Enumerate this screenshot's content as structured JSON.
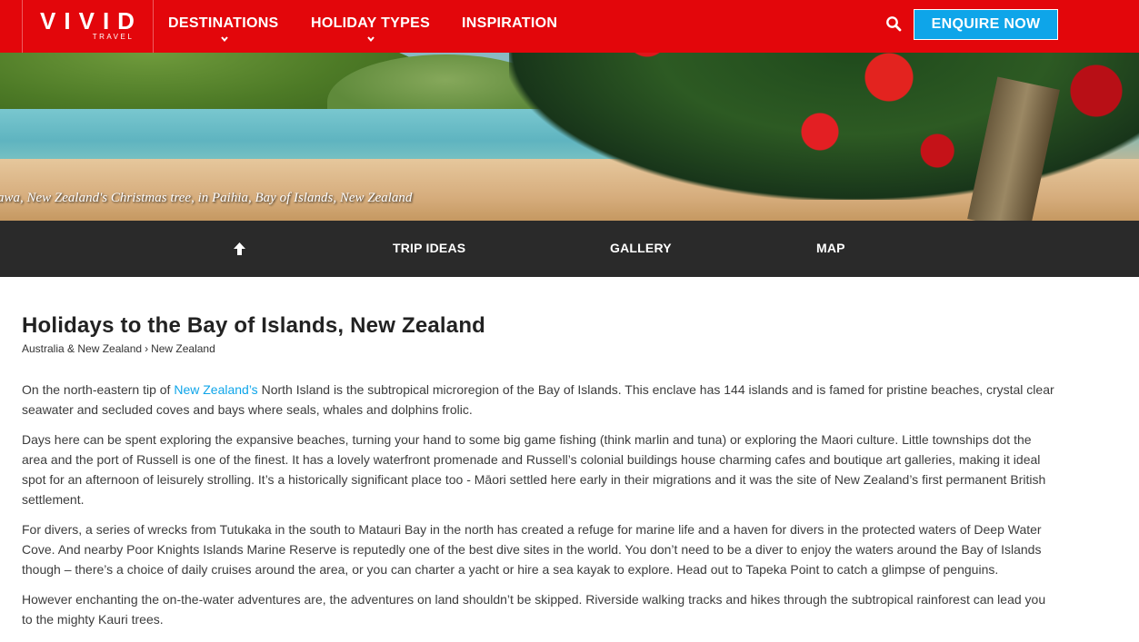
{
  "colors": {
    "brand_red": "#e3060b",
    "accent_blue": "#0ea5e9",
    "subnav_bg": "#2a2a2a"
  },
  "header": {
    "logo_main": "VIVID",
    "logo_sub": "TRAVEL",
    "nav": [
      {
        "label": "DESTINATIONS",
        "has_dropdown": true
      },
      {
        "label": "HOLIDAY TYPES",
        "has_dropdown": true
      },
      {
        "label": "INSPIRATION",
        "has_dropdown": false
      }
    ],
    "search_icon": "search-icon",
    "enquire_label": "ENQUIRE NOW"
  },
  "hero": {
    "caption": "awa, New Zealand's Christmas tree, in Paihia, Bay of Islands, New Zealand"
  },
  "subnav": {
    "back_to_top_icon": "arrow-up-icon",
    "items": [
      {
        "label": "TRIP IDEAS"
      },
      {
        "label": "GALLERY"
      },
      {
        "label": "MAP"
      }
    ]
  },
  "main": {
    "title": "Holidays to the Bay of Islands, New Zealand",
    "breadcrumb": {
      "parent": "Australia & New Zealand",
      "separator": "›",
      "current": "New Zealand"
    },
    "intro": {
      "before": "On the north-eastern tip of ",
      "link": "New Zealand’s",
      "after": " North Island is the subtropical microregion of the Bay of Islands. This enclave has 144 islands and is famed for pristine beaches, crystal clear seawater and secluded coves and bays where seals, whales and dolphins frolic."
    },
    "paragraphs": [
      "Days here can be spent exploring the expansive beaches, turning your hand to some big game fishing (think marlin and tuna) or exploring the Maori culture. Little townships dot the area and the port of Russell is one of the finest. It has a lovely waterfront promenade and Russell’s colonial buildings house charming cafes and boutique art galleries, making it ideal spot for an afternoon of leisurely strolling. It’s a historically significant place too - Māori settled here early in their migrations and it was the site of New Zealand’s first permanent British settlement.",
      "For divers, a series of wrecks from Tutukaka in the south to Matauri Bay in the north has created a refuge for marine life and a haven for divers in the protected waters of Deep Water Cove. And nearby Poor Knights Islands Marine Reserve is reputedly one of the best dive sites in the world. You don’t need to be a diver to enjoy the waters around the Bay of Islands though – there’s a choice of daily cruises around the area, or you can charter a yacht or hire a sea kayak to explore. Head out to Tapeka Point to catch a glimpse of penguins.",
      "However enchanting the on-the-water adventures are, the adventures on land shouldn’t be skipped. Riverside walking tracks and hikes through the subtropical rainforest can lead you to the mighty Kauri trees."
    ]
  }
}
